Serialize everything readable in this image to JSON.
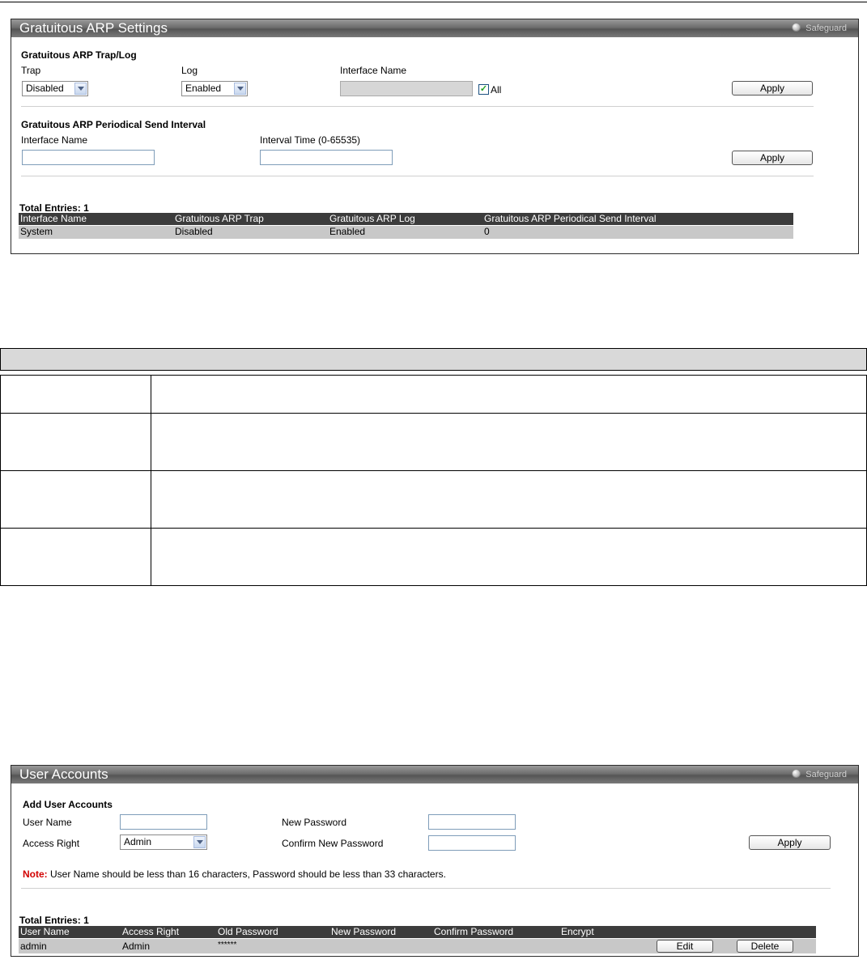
{
  "arp": {
    "title": "Gratuitous ARP Settings",
    "safeguard": "Safeguard",
    "section1_title": "Gratuitous ARP Trap/Log",
    "trap_label": "Trap",
    "trap_value": "Disabled",
    "log_label": "Log",
    "log_value": "Enabled",
    "iface_label": "Interface Name",
    "iface_value": "",
    "all_label": "All",
    "all_checked": true,
    "apply1": "Apply",
    "section2_title": "Gratuitous ARP Periodical Send Interval",
    "iface2_label": "Interface Name",
    "interval_label": "Interval Time (0-65535)",
    "iface2_value": "",
    "interval_value": "",
    "apply2": "Apply",
    "total_entries": "Total Entries: 1",
    "columns": [
      "Interface Name",
      "Gratuitous ARP Trap",
      "Gratuitous ARP Log",
      "Gratuitous ARP Periodical Send Interval"
    ],
    "rows": [
      [
        "System",
        "Disabled",
        "Enabled",
        "0"
      ]
    ]
  },
  "desc_table": {
    "header": "",
    "rows": [
      {
        "param": "",
        "description": ""
      },
      {
        "param": "",
        "description": ""
      },
      {
        "param": "",
        "description": ""
      },
      {
        "param": "",
        "description": ""
      }
    ]
  },
  "users": {
    "title": "User Accounts",
    "safeguard": "Safeguard",
    "section_title": "Add User Accounts",
    "username_label": "User Name",
    "username_value": "",
    "access_label": "Access Right",
    "access_value": "Admin",
    "new_pw_label": "New Password",
    "confirm_pw_label": "Confirm New Password",
    "new_pw_value": "",
    "confirm_pw_value": "",
    "apply": "Apply",
    "note_prefix": "Note:",
    "note_text": " User Name should be less than 16 characters, Password should be less than 33 characters.",
    "total_entries": "Total Entries: 1",
    "columns": [
      "User Name",
      "Access Right",
      "Old Password",
      "New Password",
      "Confirm Password",
      "Encrypt"
    ],
    "rows": [
      {
        "user": "admin",
        "access": "Admin",
        "old_pw": "******",
        "new_pw": "",
        "confirm_pw": "",
        "encrypt": "",
        "edit": "Edit",
        "delete": "Delete"
      }
    ]
  },
  "colors": {
    "note_red": "#d20000",
    "header_dark": "#3c3c3c",
    "row_gray": "#c8c8c8"
  }
}
